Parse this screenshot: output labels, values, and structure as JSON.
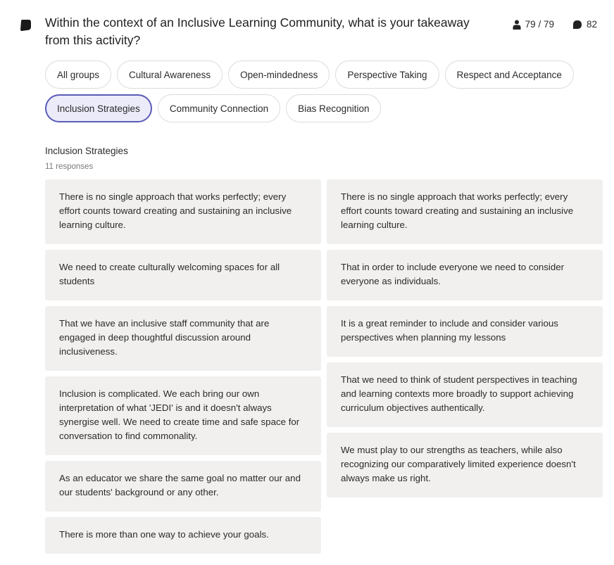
{
  "question": "Within the context of an Inclusive Learning Community, what is your takeaway from this activity?",
  "stats": {
    "participants": "79 / 79",
    "responses": "82"
  },
  "groups": [
    {
      "label": "All groups",
      "active": false
    },
    {
      "label": "Cultural Awareness",
      "active": false
    },
    {
      "label": "Open-mindedness",
      "active": false
    },
    {
      "label": "Perspective Taking",
      "active": false
    },
    {
      "label": "Respect and Acceptance",
      "active": false
    },
    {
      "label": "Inclusion Strategies",
      "active": true
    },
    {
      "label": "Community Connection",
      "active": false
    },
    {
      "label": "Bias Recognition",
      "active": false
    }
  ],
  "section": {
    "title": "Inclusion Strategies",
    "count": "11 responses"
  },
  "colors": {
    "accent": "#5b5bb8",
    "accent_bg": "#ecebfa",
    "card_bg": "#f1f0ef"
  },
  "responses": {
    "left": [
      "There is no single approach that works perfectly; every effort counts toward creating and sustaining an inclusive learning culture.",
      "We need to create culturally welcoming spaces for all students",
      "That we have an inclusive staff community that are engaged in deep thoughtful discussion around inclusiveness.",
      "Inclusion is complicated. We each bring our own interpretation of what 'JEDI' is and it doesn't always synergise well. We need to create time and safe space for conversation to find commonality.",
      "As an educator we share the same goal no matter our and our students' background or any other.",
      "There is more than one way to achieve your goals."
    ],
    "right": [
      "There is no single approach that works perfectly; every effort counts toward creating and sustaining an inclusive learning culture.",
      "That in order to include everyone we need to consider everyone as individuals.",
      "It is a great reminder to include and consider various perspectives when planning my lessons",
      "That we need to think of student perspectives in teaching and learning contexts more broadly to support achieving curriculum objectives authentically.",
      "We must play to our strengths as teachers, while also recognizing our comparatively limited experience doesn't always make us right."
    ]
  }
}
